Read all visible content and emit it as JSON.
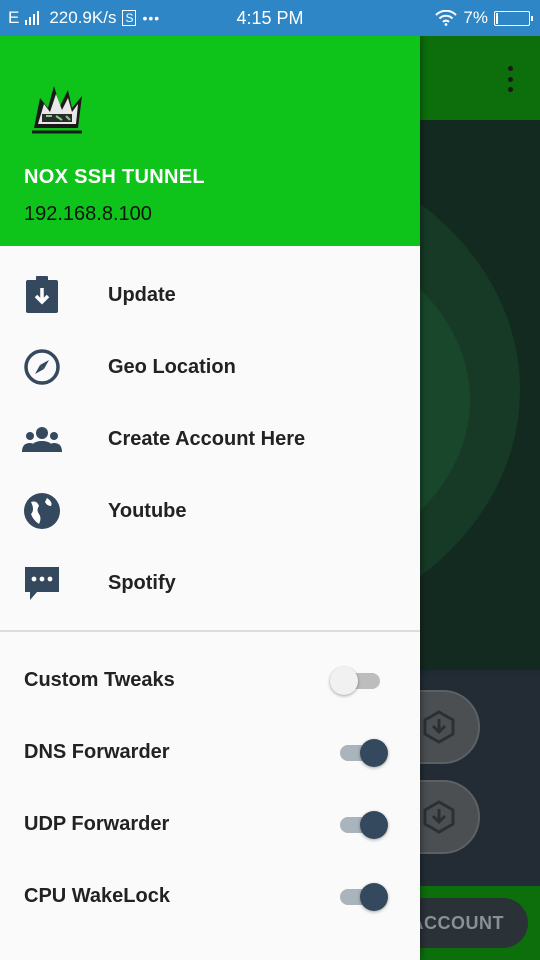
{
  "status_bar": {
    "carrier_icon": "E",
    "speed": "220.9K/s",
    "s_icon": "S",
    "dots": "•••",
    "time": "4:15 PM",
    "battery_percent": "7%",
    "battery_level": 0.07
  },
  "drawer": {
    "app_name": "NOX SSH TUNNEL",
    "ip_address": "192.168.8.100",
    "menu": [
      {
        "label": "Update",
        "icon": "download-clipboard-icon"
      },
      {
        "label": "Geo Location",
        "icon": "compass-icon"
      },
      {
        "label": "Create Account Here",
        "icon": "group-icon"
      },
      {
        "label": "Youtube",
        "icon": "globe-icon"
      },
      {
        "label": "Spotify",
        "icon": "chat-bubble-icon"
      }
    ],
    "switches": [
      {
        "label": "Custom Tweaks",
        "on": false
      },
      {
        "label": "DNS Forwarder",
        "on": true
      },
      {
        "label": "UDP Forwarder",
        "on": true
      },
      {
        "label": "CPU WakeLock",
        "on": true
      }
    ]
  },
  "background_app": {
    "account_button_label": "ACCOUNT"
  },
  "colors": {
    "header_green": "#0ec41a",
    "status_blue": "#2e86c6",
    "icon_dark": "#34495e"
  }
}
